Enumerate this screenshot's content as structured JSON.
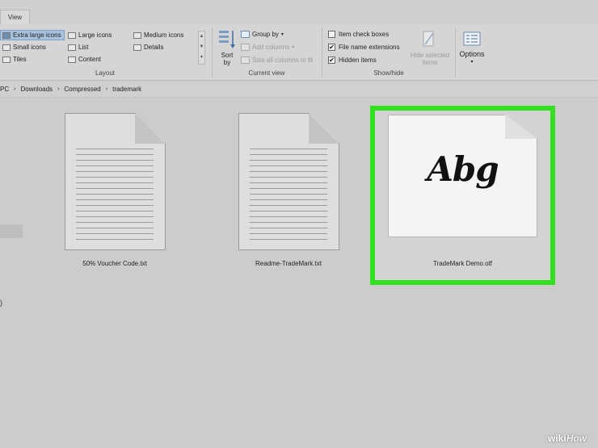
{
  "tab": {
    "view": "View"
  },
  "layout": {
    "items": [
      "Extra large icons",
      "Large icons",
      "Medium icons",
      "Small icons",
      "List",
      "Details",
      "Tiles",
      "Content"
    ],
    "label": "Layout"
  },
  "current_view": {
    "sort_by": "Sort by",
    "group_by": "Group by",
    "add_columns": "Add columns",
    "size_all_columns": "Size all columns to fit",
    "label": "Current view"
  },
  "show_hide": {
    "item_check_boxes": {
      "label": "Item check boxes",
      "checked": false
    },
    "file_name_extensions": {
      "label": "File name extensions",
      "checked": true
    },
    "hidden_items": {
      "label": "Hidden items",
      "checked": true
    },
    "hide_selected_line1": "Hide selected",
    "hide_selected_line2": "items",
    "label": "Show/hide"
  },
  "options": {
    "label": "Options"
  },
  "address": {
    "crumbs": [
      "PC",
      "Downloads",
      "Compressed",
      "trademark"
    ]
  },
  "nav_fragment": ")",
  "files": [
    {
      "name": "50% Voucher Code.txt",
      "icon": "text-document-icon"
    },
    {
      "name": "Readme-TradeMark.txt",
      "icon": "text-document-icon"
    },
    {
      "name": "TradeMark Demo.otf",
      "icon": "font-file-icon",
      "preview": "Abg",
      "selected": true
    }
  ],
  "highlight_color": "#33e01f",
  "watermark": {
    "wiki": "wiki",
    "how": "How"
  }
}
